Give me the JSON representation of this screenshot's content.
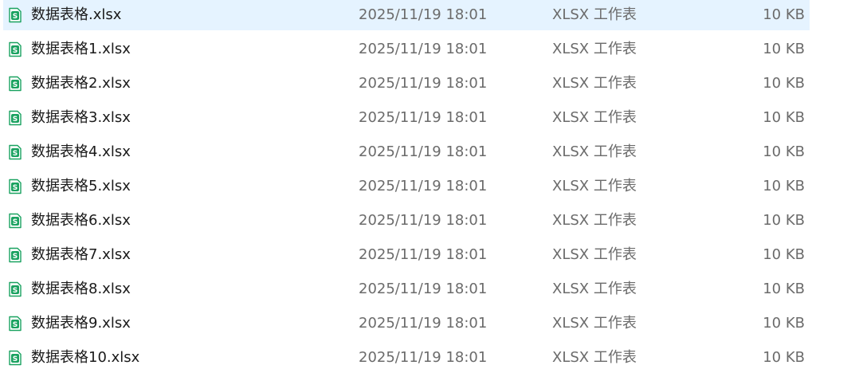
{
  "files": [
    {
      "name": "数据表格.xlsx",
      "modified": "2025/11/19 18:01",
      "type": "XLSX 工作表",
      "size": "10 KB",
      "selected": true
    },
    {
      "name": "数据表格1.xlsx",
      "modified": "2025/11/19 18:01",
      "type": "XLSX 工作表",
      "size": "10 KB"
    },
    {
      "name": "数据表格2.xlsx",
      "modified": "2025/11/19 18:01",
      "type": "XLSX 工作表",
      "size": "10 KB"
    },
    {
      "name": "数据表格3.xlsx",
      "modified": "2025/11/19 18:01",
      "type": "XLSX 工作表",
      "size": "10 KB"
    },
    {
      "name": "数据表格4.xlsx",
      "modified": "2025/11/19 18:01",
      "type": "XLSX 工作表",
      "size": "10 KB"
    },
    {
      "name": "数据表格5.xlsx",
      "modified": "2025/11/19 18:01",
      "type": "XLSX 工作表",
      "size": "10 KB"
    },
    {
      "name": "数据表格6.xlsx",
      "modified": "2025/11/19 18:01",
      "type": "XLSX 工作表",
      "size": "10 KB"
    },
    {
      "name": "数据表格7.xlsx",
      "modified": "2025/11/19 18:01",
      "type": "XLSX 工作表",
      "size": "10 KB"
    },
    {
      "name": "数据表格8.xlsx",
      "modified": "2025/11/19 18:01",
      "type": "XLSX 工作表",
      "size": "10 KB"
    },
    {
      "name": "数据表格9.xlsx",
      "modified": "2025/11/19 18:01",
      "type": "XLSX 工作表",
      "size": "10 KB"
    },
    {
      "name": "数据表格10.xlsx",
      "modified": "2025/11/19 18:01",
      "type": "XLSX 工作表",
      "size": "10 KB"
    }
  ],
  "icon": {
    "name": "spreadsheet-file-icon",
    "glyph": "S",
    "color": "#1aa260"
  },
  "colors": {
    "selected_row": "#e5f3ff"
  }
}
